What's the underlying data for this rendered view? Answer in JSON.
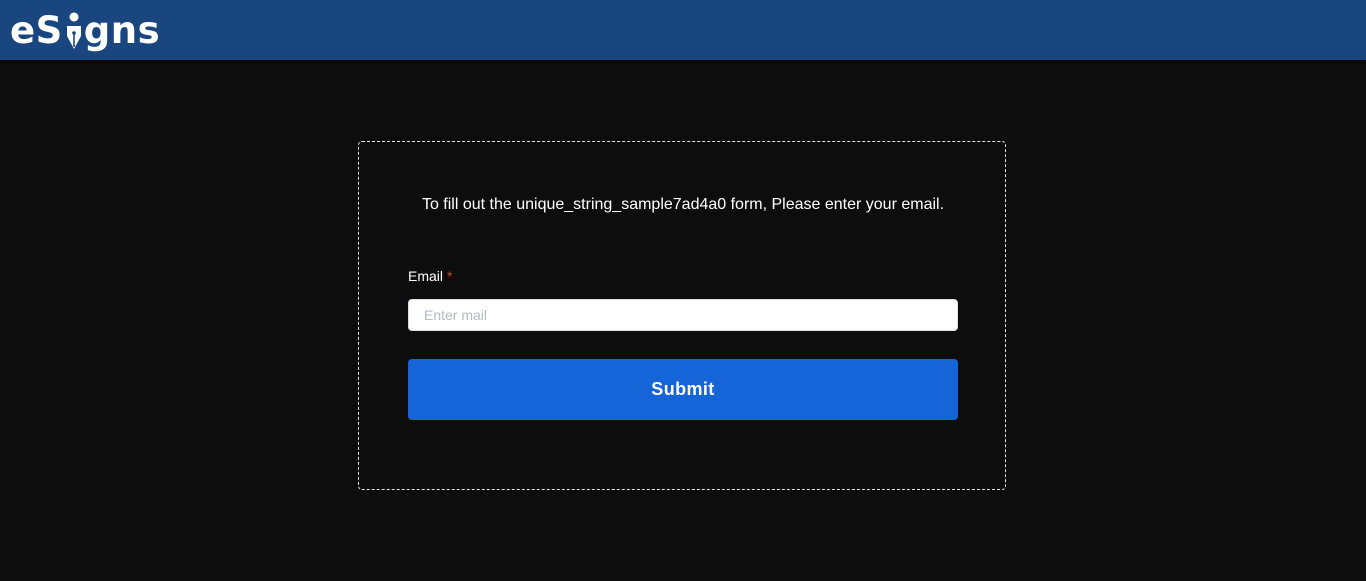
{
  "header": {
    "logo_prefix": "e",
    "logo_s": "S",
    "logo_suffix": "gns",
    "logo_text": "eSigns"
  },
  "form": {
    "intro": "To fill out the unique_string_sample7ad4a0 form, Please enter your email.",
    "email_label": "Email",
    "required_marker": "*",
    "email_placeholder": "Enter mail",
    "email_value": "",
    "submit_label": "Submit"
  },
  "colors": {
    "header_bg": "#1a4680",
    "page_bg": "#0d0d0d",
    "button_bg": "#1665d8",
    "required": "#e83a3a"
  }
}
